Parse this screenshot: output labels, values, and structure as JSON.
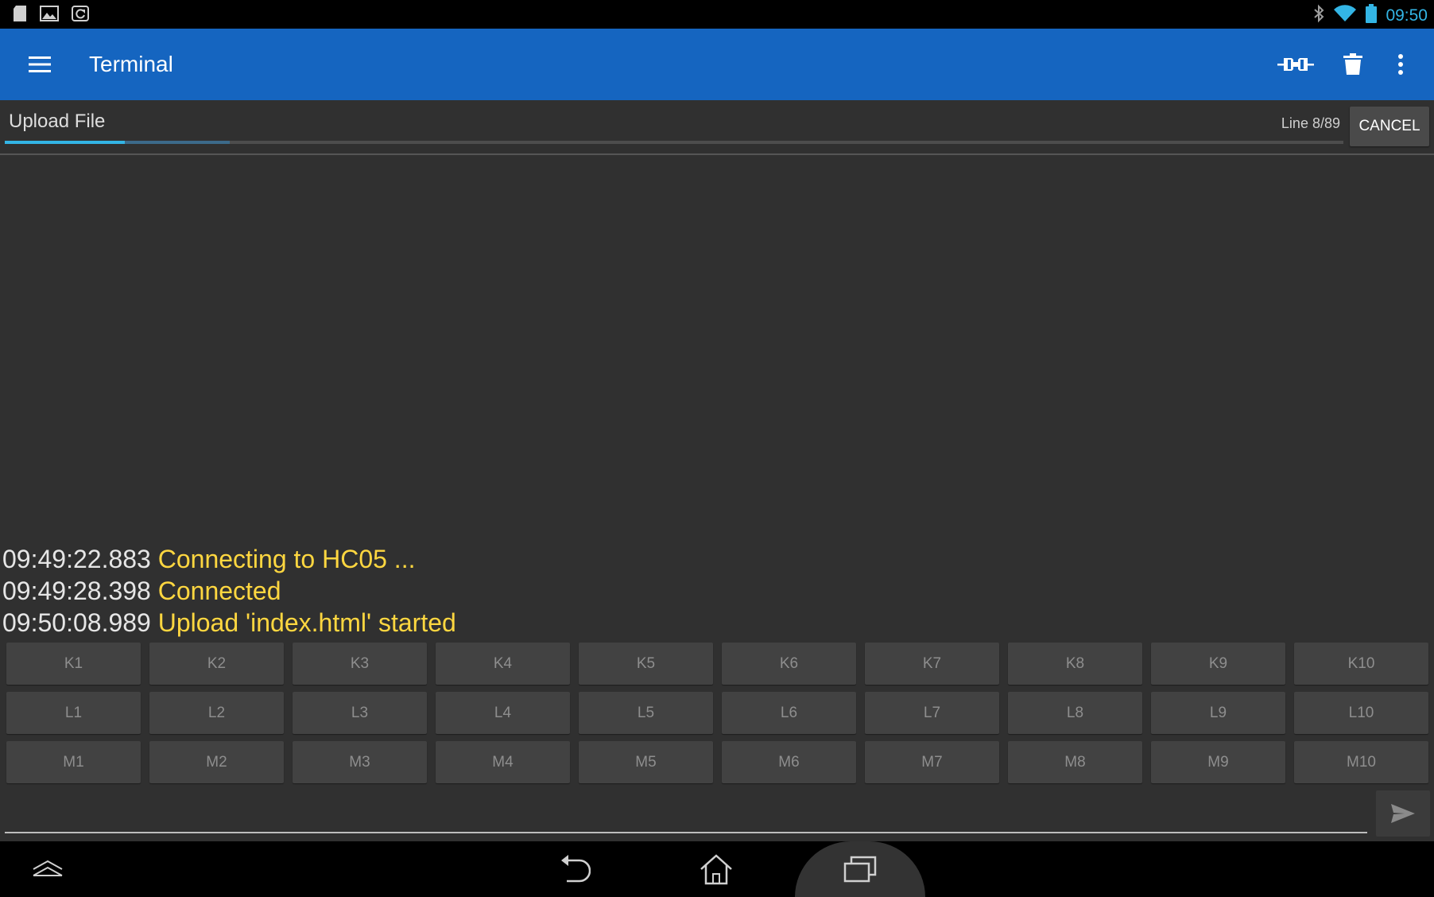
{
  "status_bar": {
    "time": "09:50",
    "left_icons": [
      "sd-card-icon",
      "image-icon",
      "sync-icon"
    ],
    "right_icons": [
      "bluetooth-icon",
      "wifi-icon",
      "battery-icon"
    ]
  },
  "app_bar": {
    "title": "Terminal",
    "actions": [
      "connect-icon",
      "delete-icon",
      "overflow-menu-icon"
    ]
  },
  "upload": {
    "label": "Upload File",
    "line_status": "Line 8/89",
    "cancel_label": "CANCEL",
    "progress_fraction": 0.0899,
    "buffer_fraction": 0.078
  },
  "log": [
    {
      "time": "09:49:22.883",
      "message": "Connecting to HC05 ..."
    },
    {
      "time": "09:49:28.398",
      "message": "Connected"
    },
    {
      "time": "09:50:08.989",
      "message": "Upload 'index.html' started"
    }
  ],
  "macro_rows": [
    [
      "K1",
      "K2",
      "K3",
      "K4",
      "K5",
      "K6",
      "K7",
      "K8",
      "K9",
      "K10"
    ],
    [
      "L1",
      "L2",
      "L3",
      "L4",
      "L5",
      "L6",
      "L7",
      "L8",
      "L9",
      "L10"
    ],
    [
      "M1",
      "M2",
      "M3",
      "M4",
      "M5",
      "M6",
      "M7",
      "M8",
      "M9",
      "M10"
    ]
  ],
  "input": {
    "value": "",
    "placeholder": ""
  },
  "colors": {
    "app_bar": "#1565c0",
    "background": "#303030",
    "log_message": "#ffd740",
    "accent": "#33b5e5"
  }
}
